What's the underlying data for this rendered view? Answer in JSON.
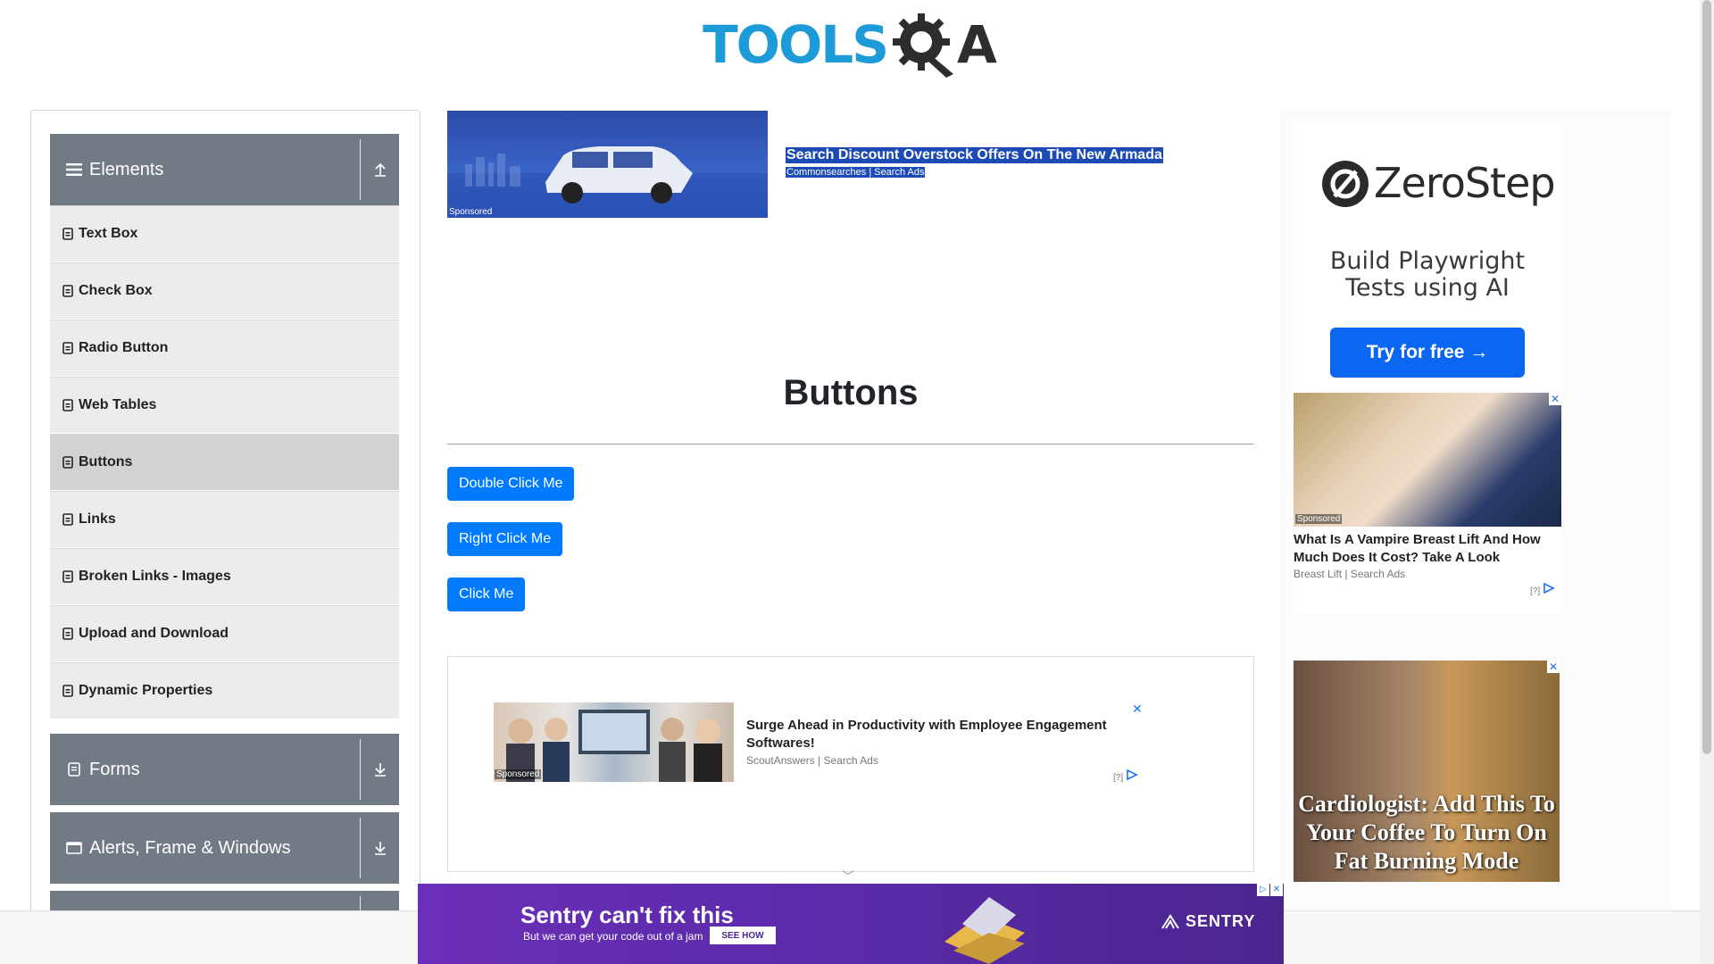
{
  "header": {
    "logo_text": "TOOLS",
    "logo_suffix": "A"
  },
  "sidebar": {
    "groups": [
      {
        "label": "Elements",
        "toggle": "collapse-icon"
      },
      {
        "label": "Forms",
        "toggle": "expand-icon"
      },
      {
        "label": "Alerts, Frame & Windows",
        "toggle": "expand-icon"
      }
    ],
    "items": [
      {
        "label": "Text Box"
      },
      {
        "label": "Check Box"
      },
      {
        "label": "Radio Button"
      },
      {
        "label": "Web Tables"
      },
      {
        "label": "Buttons",
        "active": true
      },
      {
        "label": "Links"
      },
      {
        "label": "Broken Links - Images"
      },
      {
        "label": "Upload and Download"
      },
      {
        "label": "Dynamic Properties"
      }
    ]
  },
  "top_ad": {
    "sponsored": "Sponsored",
    "title": "Search Discount Overstock Offers On The New Armada",
    "source": "Commonsearches | Search Ads"
  },
  "main": {
    "title": "Buttons",
    "buttons": [
      {
        "label": "Double Click Me"
      },
      {
        "label": "Right Click Me"
      },
      {
        "label": "Click Me"
      }
    ]
  },
  "mid_ad": {
    "sponsored": "Sponsored",
    "title": "Surge Ahead in Productivity with Employee Engagement Softwares!",
    "source": "ScoutAnswers | Search Ads",
    "close": "✕",
    "help": "[?]"
  },
  "right_ads": {
    "zerostep": {
      "name": "ZeroStep",
      "tagline_1": "Build Playwright",
      "tagline_2": "Tests using AI",
      "cta": "Try for free →"
    },
    "ad2": {
      "sponsored": "Sponsored",
      "title": "What Is A Vampire Breast Lift And How Much Does It Cost? Take A Look",
      "source": "Breast Lift | Search Ads",
      "help": "[?]",
      "close": "✕"
    },
    "ad3": {
      "text": "Cardiologist: Add This To Your Coffee To Turn On Fat Burning Mode",
      "close": "✕"
    }
  },
  "bottom_ad": {
    "headline": "Sentry can't fix this",
    "subline": "But we can get your code out of a jam",
    "cta": "SEE HOW",
    "brand": "SENTRY",
    "controls": [
      "▷",
      "✕"
    ]
  },
  "colors": {
    "primary": "#007bff",
    "sidebar_header": "#727b85",
    "logo_blue": "#1d9bd8",
    "ad_highlight": "#1d4bb5"
  }
}
